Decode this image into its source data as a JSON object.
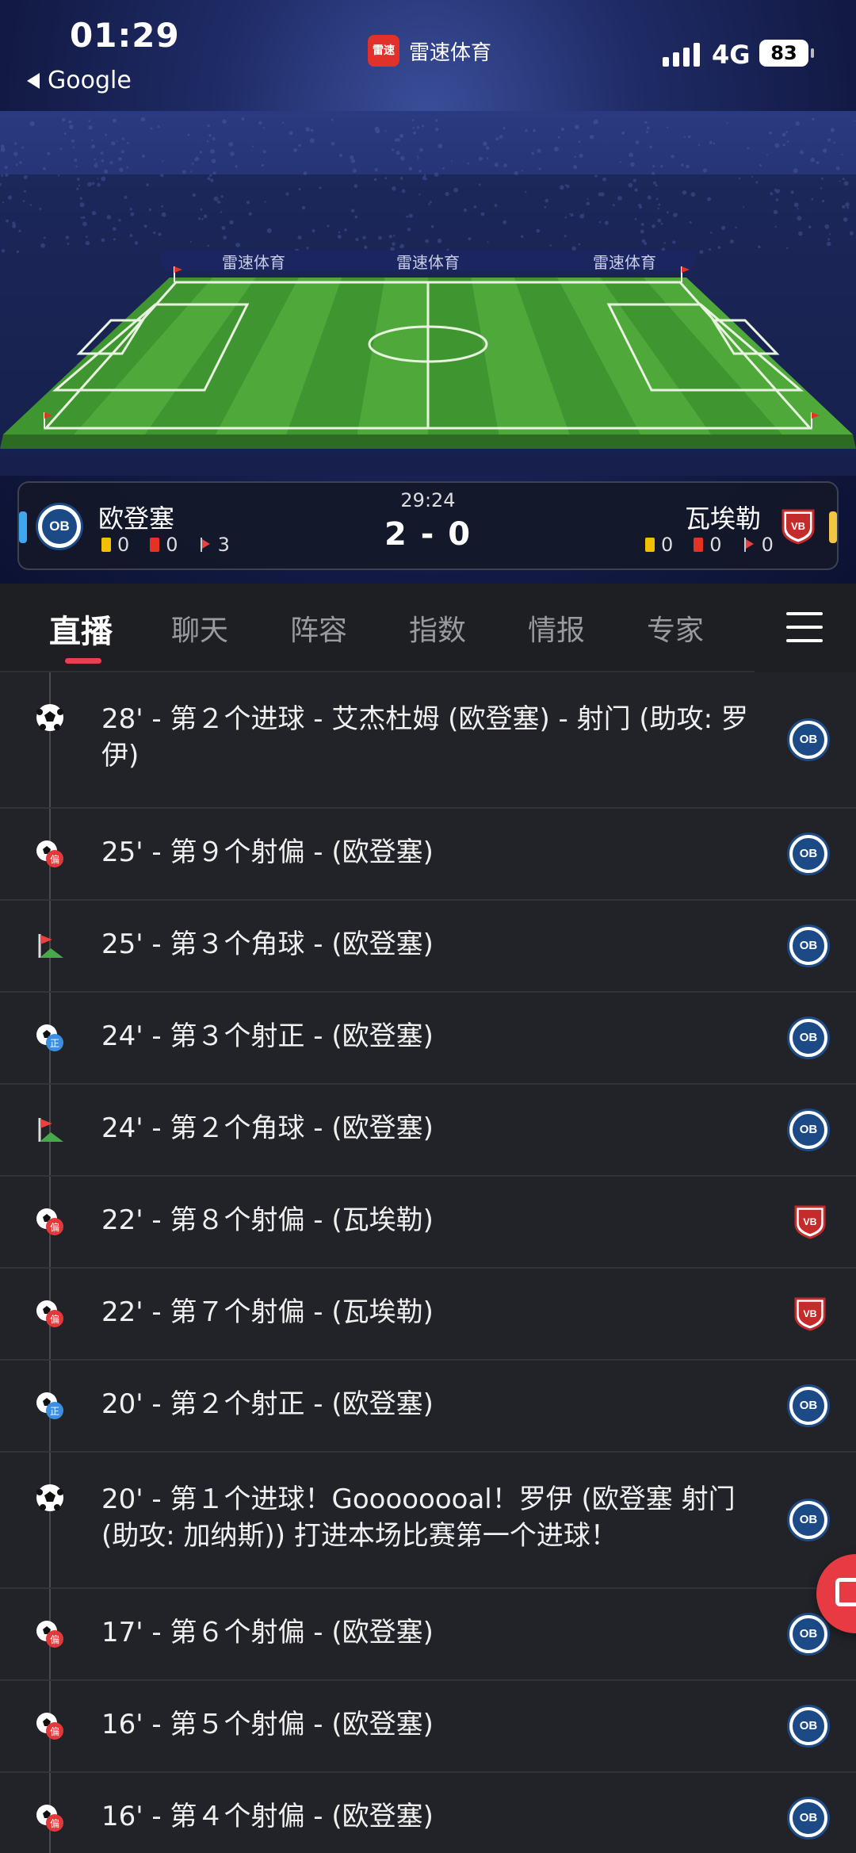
{
  "status_bar": {
    "time": "01:29",
    "back_label": "Google",
    "network": "4G",
    "battery": "83"
  },
  "app": {
    "name": "雷速体育",
    "logo_text": "雷速"
  },
  "stadium": {
    "ad_text": "雷速体育"
  },
  "match": {
    "time": "29:24",
    "score": "2 - 0",
    "home": {
      "name": "欧登塞",
      "badge": "OB",
      "yellow": "0",
      "red": "0",
      "corners": "3",
      "color": "#3fa7f0"
    },
    "away": {
      "name": "瓦埃勒",
      "badge": "VB",
      "yellow": "0",
      "red": "0",
      "corners": "0",
      "color": "#f2c643"
    }
  },
  "tabs": [
    "直播",
    "聊天",
    "阵容",
    "指数",
    "情报",
    "专家"
  ],
  "events": [
    {
      "text": "28' - 第２个进球 - 艾杰杜姆 (欧登塞) - 射门 (助攻: 罗伊)",
      "icon": "ball-icon",
      "team": "home"
    },
    {
      "text": "25' - 第９个射偏 - (欧登塞)",
      "icon": "shot-off-target-icon",
      "team": "home"
    },
    {
      "text": "25' - 第３个角球 - (欧登塞)",
      "icon": "corner-flag-icon",
      "team": "home"
    },
    {
      "text": "24' - 第３个射正 - (欧登塞)",
      "icon": "shot-on-target-icon",
      "team": "home"
    },
    {
      "text": "24' - 第２个角球 - (欧登塞)",
      "icon": "corner-flag-icon",
      "team": "home"
    },
    {
      "text": "22' - 第８个射偏 - (瓦埃勒)",
      "icon": "shot-off-target-icon",
      "team": "away"
    },
    {
      "text": "22' - 第７个射偏 - (瓦埃勒)",
      "icon": "shot-off-target-icon",
      "team": "away"
    },
    {
      "text": "20' - 第２个射正 - (欧登塞)",
      "icon": "shot-on-target-icon",
      "team": "home"
    },
    {
      "text": "20' - 第１个进球！Goooooooal！罗伊 (欧登塞 射门 (助攻: 加纳斯)) 打进本场比赛第一个进球！",
      "icon": "ball-icon",
      "team": "home"
    },
    {
      "text": "17' - 第６个射偏 - (欧登塞)",
      "icon": "shot-off-target-icon",
      "team": "home"
    },
    {
      "text": "16' - 第５个射偏 - (欧登塞)",
      "icon": "shot-off-target-icon",
      "team": "home"
    },
    {
      "text": "16' - 第４个射偏 - (欧登塞)",
      "icon": "shot-off-target-icon",
      "team": "home"
    }
  ],
  "icon_labels": {
    "off_target": "偏",
    "on_target": "正"
  },
  "colors": {
    "accent": "#e94050",
    "pitch_light": "#4fa83a",
    "pitch_dark": "#3f9630",
    "background": "#222328"
  }
}
